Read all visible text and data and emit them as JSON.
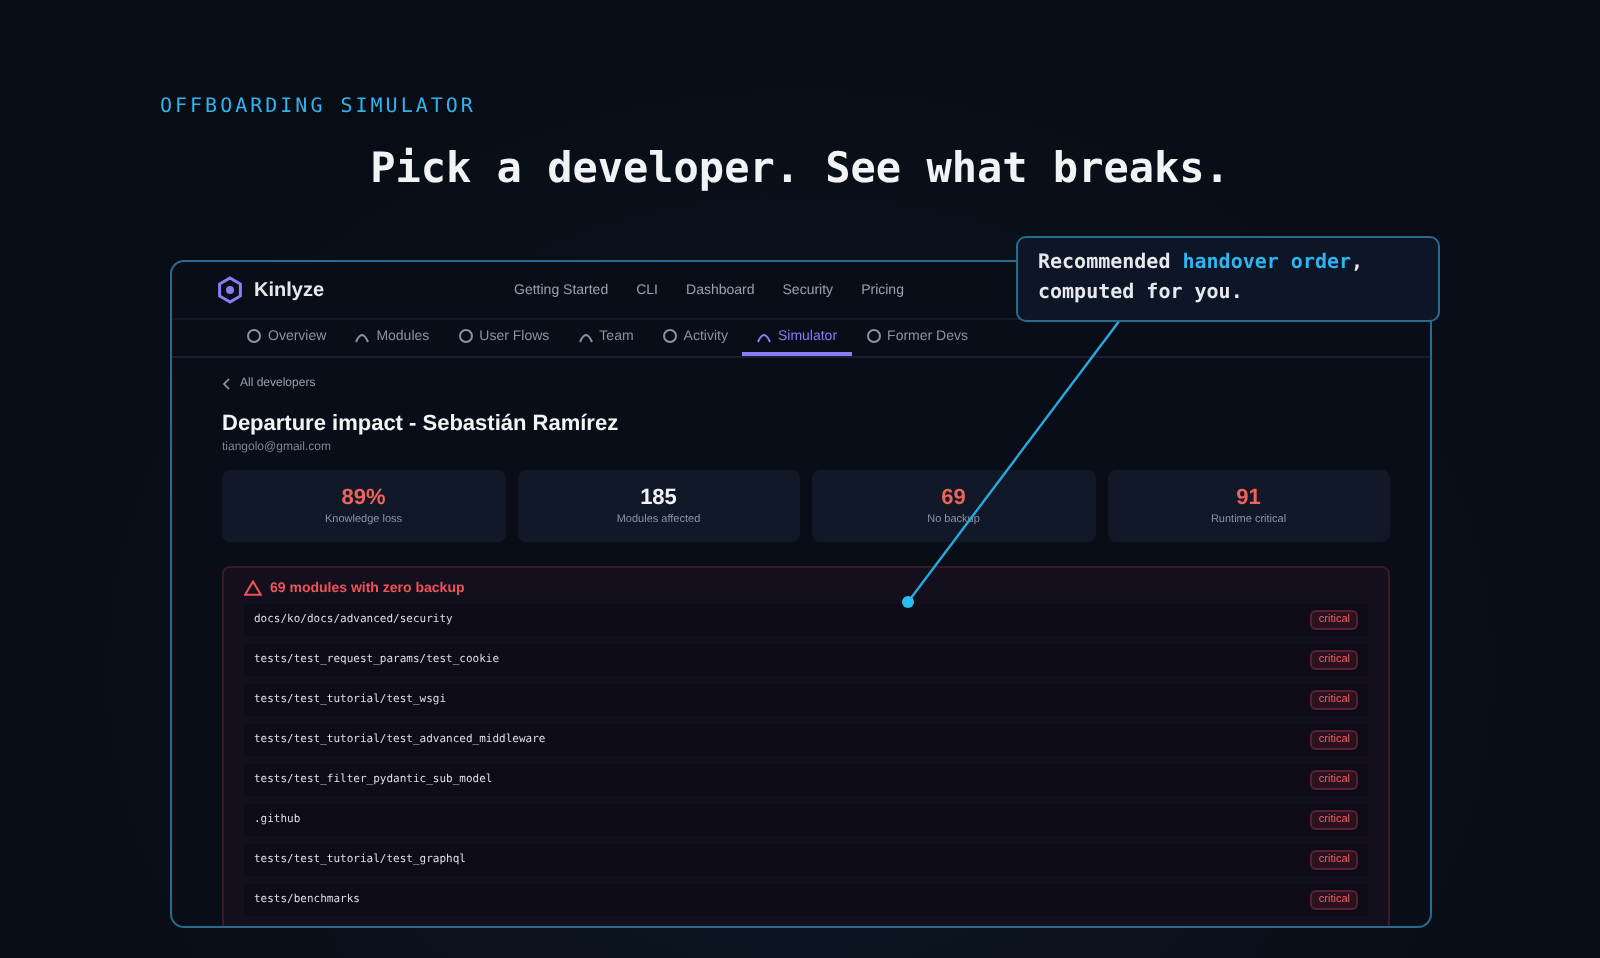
{
  "eyebrow": "OFFBOARDING SIMULATOR",
  "headline": "Pick a developer. See what breaks.",
  "callout": {
    "text": "Recommended **handover order**,\ncomputed for you."
  },
  "app": {
    "brand": "Kinlyze",
    "nav": [
      "Getting Started",
      "CLI",
      "Dashboard",
      "Security",
      "Pricing"
    ],
    "tabs": [
      {
        "label": "Overview",
        "selected": false
      },
      {
        "label": "Modules",
        "selected": false
      },
      {
        "label": "User Flows",
        "selected": false
      },
      {
        "label": "Team",
        "selected": false
      },
      {
        "label": "Activity",
        "selected": false
      },
      {
        "label": "Simulator",
        "selected": true
      },
      {
        "label": "Former Devs",
        "selected": false
      }
    ],
    "back_link": "All developers",
    "title": "Departure impact - Sebastián Ramírez",
    "email": "tiangolo@gmail.com",
    "stats": [
      {
        "value": "89%",
        "label": "Knowledge loss",
        "alert": true
      },
      {
        "value": "185",
        "label": "Modules affected",
        "alert": false
      },
      {
        "value": "69",
        "label": "No backup",
        "alert": true
      },
      {
        "value": "91",
        "label": "Runtime critical",
        "alert": true
      }
    ],
    "warning": {
      "title": "69 modules with zero backup",
      "rows": [
        {
          "path": "docs/ko/docs/advanced/security",
          "badge": "critical"
        },
        {
          "path": "tests/test_request_params/test_cookie",
          "badge": "critical"
        },
        {
          "path": "tests/test_tutorial/test_wsgi",
          "badge": "critical"
        },
        {
          "path": "tests/test_tutorial/test_advanced_middleware",
          "badge": "critical"
        },
        {
          "path": "tests/test_filter_pydantic_sub_model",
          "badge": "critical"
        },
        {
          "path": ".github",
          "badge": "critical"
        },
        {
          "path": "tests/test_tutorial/test_graphql",
          "badge": "critical"
        },
        {
          "path": "tests/benchmarks",
          "badge": "critical"
        }
      ]
    }
  }
}
